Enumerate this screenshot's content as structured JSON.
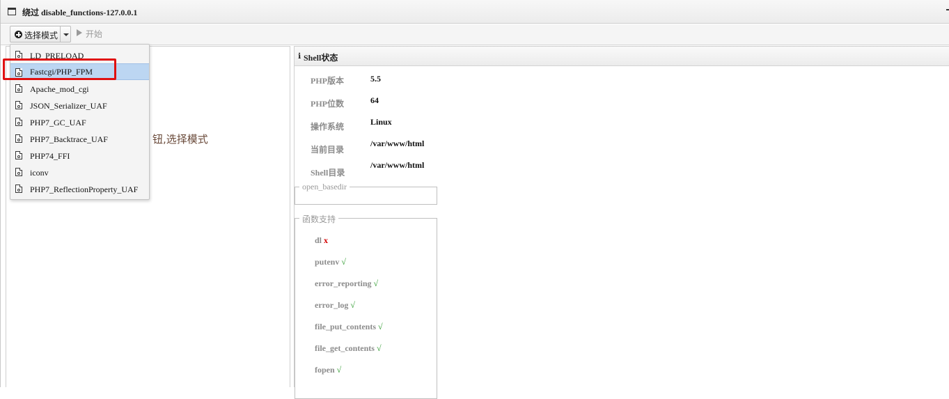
{
  "window": {
    "title": "绕过 disable_functions-127.0.0.1"
  },
  "toolbar": {
    "mode_label": "选择模式",
    "start_label": "开始"
  },
  "left_pane": {
    "hint": "钮,选择模式"
  },
  "menu": {
    "items": [
      {
        "label": "LD_PRELOAD",
        "icon": "file-code-icon"
      },
      {
        "label": "Fastcgi/PHP_FPM",
        "icon": "file-code-icon",
        "selected": true
      },
      {
        "label": "Apache_mod_cgi",
        "icon": "file-code-icon"
      },
      {
        "label": "JSON_Serializer_UAF",
        "icon": "file-code-icon"
      },
      {
        "label": "PHP7_GC_UAF",
        "icon": "file-code-icon"
      },
      {
        "label": "PHP7_Backtrace_UAF",
        "icon": "file-code-icon"
      },
      {
        "label": "PHP74_FFI",
        "icon": "file-code-icon"
      },
      {
        "label": "iconv",
        "icon": "file-code-icon"
      },
      {
        "label": "PHP7_ReflectionProperty_UAF",
        "icon": "file-code-icon"
      }
    ]
  },
  "shell_status": {
    "header": "Shell状态",
    "rows": [
      {
        "key": "PHP版本",
        "value": "5.5"
      },
      {
        "key": "PHP位数",
        "value": "64"
      },
      {
        "key": "操作系统",
        "value": "Linux"
      },
      {
        "key": "当前目录",
        "value": "/var/www/html"
      },
      {
        "key": "Shell目录",
        "value": "/var/www/html"
      }
    ],
    "open_basedir_legend": "open_basedir",
    "functions_legend": "函数支持",
    "functions": [
      {
        "name": "dl",
        "mark": "x"
      },
      {
        "name": "putenv",
        "mark": "√"
      },
      {
        "name": "error_reporting",
        "mark": "√"
      },
      {
        "name": "error_log",
        "mark": "√"
      },
      {
        "name": "file_put_contents",
        "mark": "√"
      },
      {
        "name": "file_get_contents",
        "mark": "√"
      },
      {
        "name": "fopen",
        "mark": "√"
      }
    ]
  },
  "colors": {
    "selected_item_bg": "#bcd6f2",
    "highlight_border": "#e01010",
    "supported": "#2e9b2e",
    "unsupported": "#d40000"
  }
}
